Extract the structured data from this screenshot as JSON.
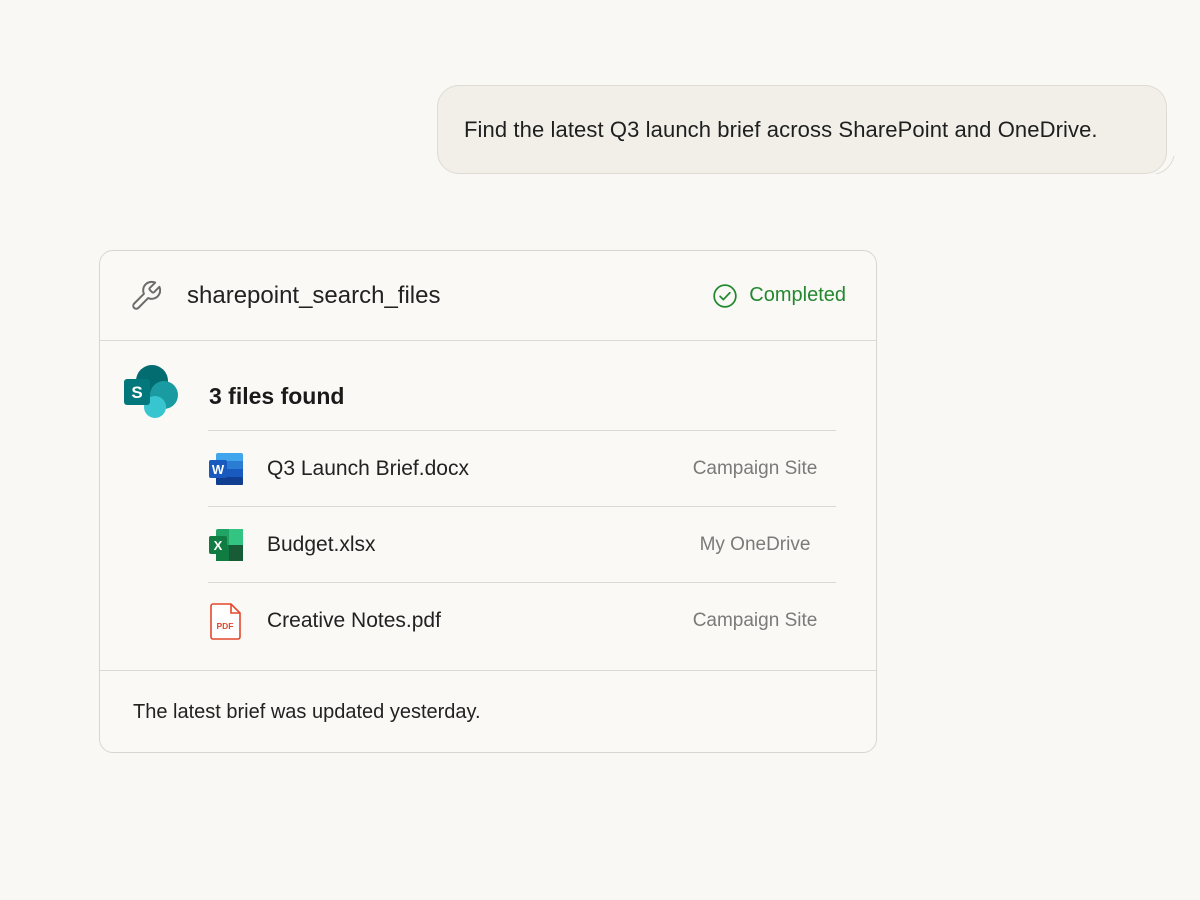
{
  "chat": {
    "user_message": "Find the latest Q3 launch brief across SharePoint and OneDrive."
  },
  "tool_card": {
    "tool_name": "sharepoint_search_files",
    "status": "Completed",
    "status_color": "#23882f",
    "source_icon": "sharepoint-logo-icon",
    "files_found": "3 files found",
    "files": [
      {
        "name": "Q3 Launch Brief.docx",
        "location": "Campaign Site",
        "icon": "word-file-icon",
        "icon_letter": "W",
        "color": "#185abd"
      },
      {
        "name": "Budget.xlsx",
        "location": "My OneDrive",
        "icon": "excel-file-icon",
        "icon_letter": "X",
        "color": "#107c41"
      },
      {
        "name": "Creative Notes.pdf",
        "location": "Campaign Site",
        "icon": "pdf-file-icon",
        "icon_letter": "PDF",
        "color": "#e2482c"
      }
    ],
    "footer_text": "The latest brief was updated yesterday."
  }
}
